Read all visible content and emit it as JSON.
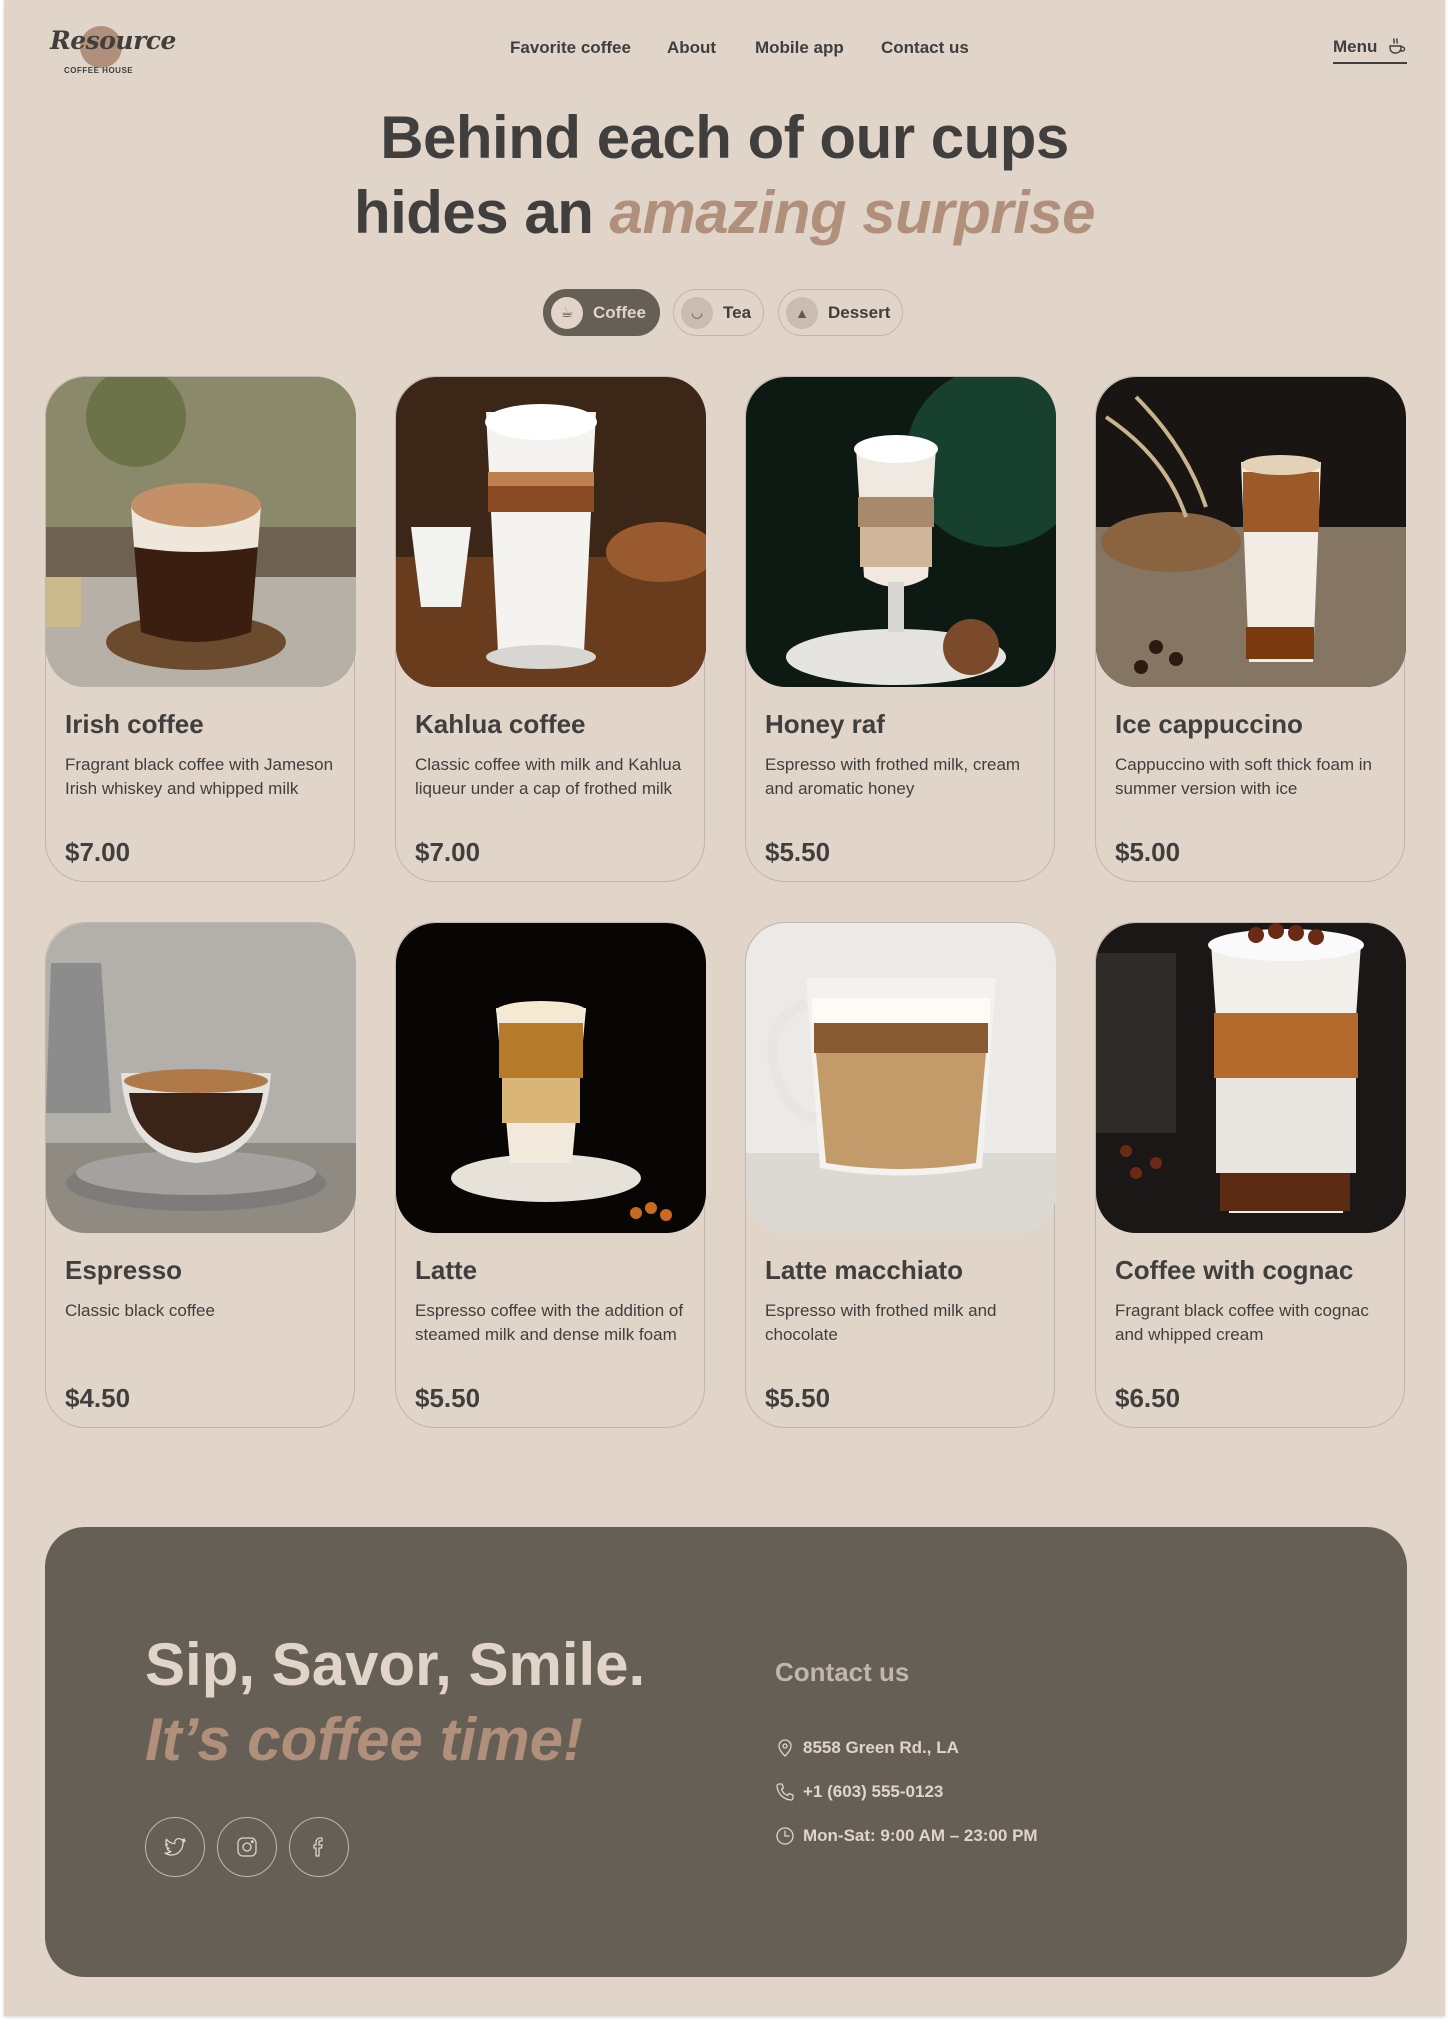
{
  "header": {
    "logo_word": "Resource",
    "logo_sub": "COFFEE HOUSE",
    "nav": [
      "Favorite coffee",
      "About",
      "Mobile app",
      "Contact us"
    ],
    "menu_label": "Menu"
  },
  "hero": {
    "line1": "Behind each of our cups",
    "line2_plain": "hides an ",
    "line2_accent": "amazing surprise"
  },
  "tabs": [
    {
      "label": "Coffee",
      "icon": "coffee-cup-icon",
      "active": true
    },
    {
      "label": "Tea",
      "icon": "tea-cup-icon",
      "active": false
    },
    {
      "label": "Dessert",
      "icon": "cake-icon",
      "active": false
    }
  ],
  "products": [
    {
      "name": "Irish coffee",
      "description": "Fragrant black coffee with Jameson Irish whiskey and whipped milk",
      "price": "$7.00"
    },
    {
      "name": "Kahlua coffee",
      "description": "Classic coffee with milk and Kahlua liqueur under a cap of frothed milk",
      "price": "$7.00"
    },
    {
      "name": "Honey raf",
      "description": "Espresso with frothed milk, cream and aromatic honey",
      "price": "$5.50"
    },
    {
      "name": "Ice cappuccino",
      "description": "Cappuccino with soft thick foam in summer version with ice",
      "price": "$5.00"
    },
    {
      "name": "Espresso",
      "description": "Classic black coffee",
      "price": "$4.50"
    },
    {
      "name": "Latte",
      "description": "Espresso coffee with the addition of steamed milk and dense milk foam",
      "price": "$5.50"
    },
    {
      "name": "Latte macchiato",
      "description": "Espresso with frothed milk and chocolate",
      "price": "$5.50"
    },
    {
      "name": "Coffee with cognac",
      "description": "Fragrant black coffee with cognac and whipped cream",
      "price": "$6.50"
    }
  ],
  "footer": {
    "slogan_line1": "Sip, Savor, Smile.",
    "slogan_line2": "It’s coffee time!",
    "socials": [
      "twitter-icon",
      "instagram-icon",
      "facebook-icon"
    ],
    "contact_title": "Contact us",
    "address": "8558 Green Rd.,  LA",
    "phone": "+1 (603) 555-0123",
    "hours": "Mon-Sat: 9:00 AM – 23:00 PM"
  },
  "colors": {
    "background": "#e1d4c9",
    "text_dark": "#403f3d",
    "accent": "#b0907a",
    "footer_bg": "#665f55",
    "border": "#c1b6ad"
  }
}
